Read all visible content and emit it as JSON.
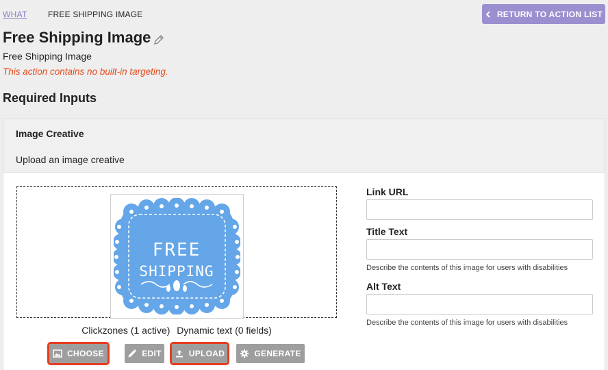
{
  "breadcrumb": {
    "root": "WHAT",
    "current": "FREE SHIPPING IMAGE"
  },
  "header": {
    "return_label": "RETURN TO ACTION LIST"
  },
  "page": {
    "title": "Free Shipping Image",
    "subtitle": "Free Shipping Image",
    "warning": "This action contains no built-in targeting.",
    "section_title": "Required Inputs"
  },
  "card": {
    "title": "Image Creative",
    "description": "Upload an image creative"
  },
  "creative": {
    "image_text_line1": "FREE",
    "image_text_line2": "SHIPPING",
    "clickzones": "Clickzones (1 active)",
    "dynamic_text": "Dynamic text (0 fields)"
  },
  "buttons": {
    "choose": "CHOOSE",
    "edit": "EDIT",
    "upload": "UPLOAD",
    "generate": "GENERATE"
  },
  "fields": {
    "link_url": {
      "label": "Link URL",
      "value": ""
    },
    "title_text": {
      "label": "Title Text",
      "value": "",
      "help": "Describe the contents of this image for users with disabilities"
    },
    "alt_text": {
      "label": "Alt Text",
      "value": "",
      "help": "Describe the contents of this image for users with disabilities"
    }
  },
  "colors": {
    "accent": "#9c8fcf",
    "warning": "#e64a19",
    "highlight": "#e53c1f",
    "button": "#9e9e9e",
    "image_blue": "#64a6e8"
  },
  "icons": {
    "return": "chevron-left-icon",
    "title_edit": "pencil-icon",
    "choose": "image-icon",
    "edit": "pencil-icon",
    "upload": "upload-icon",
    "generate": "gear-icon"
  }
}
